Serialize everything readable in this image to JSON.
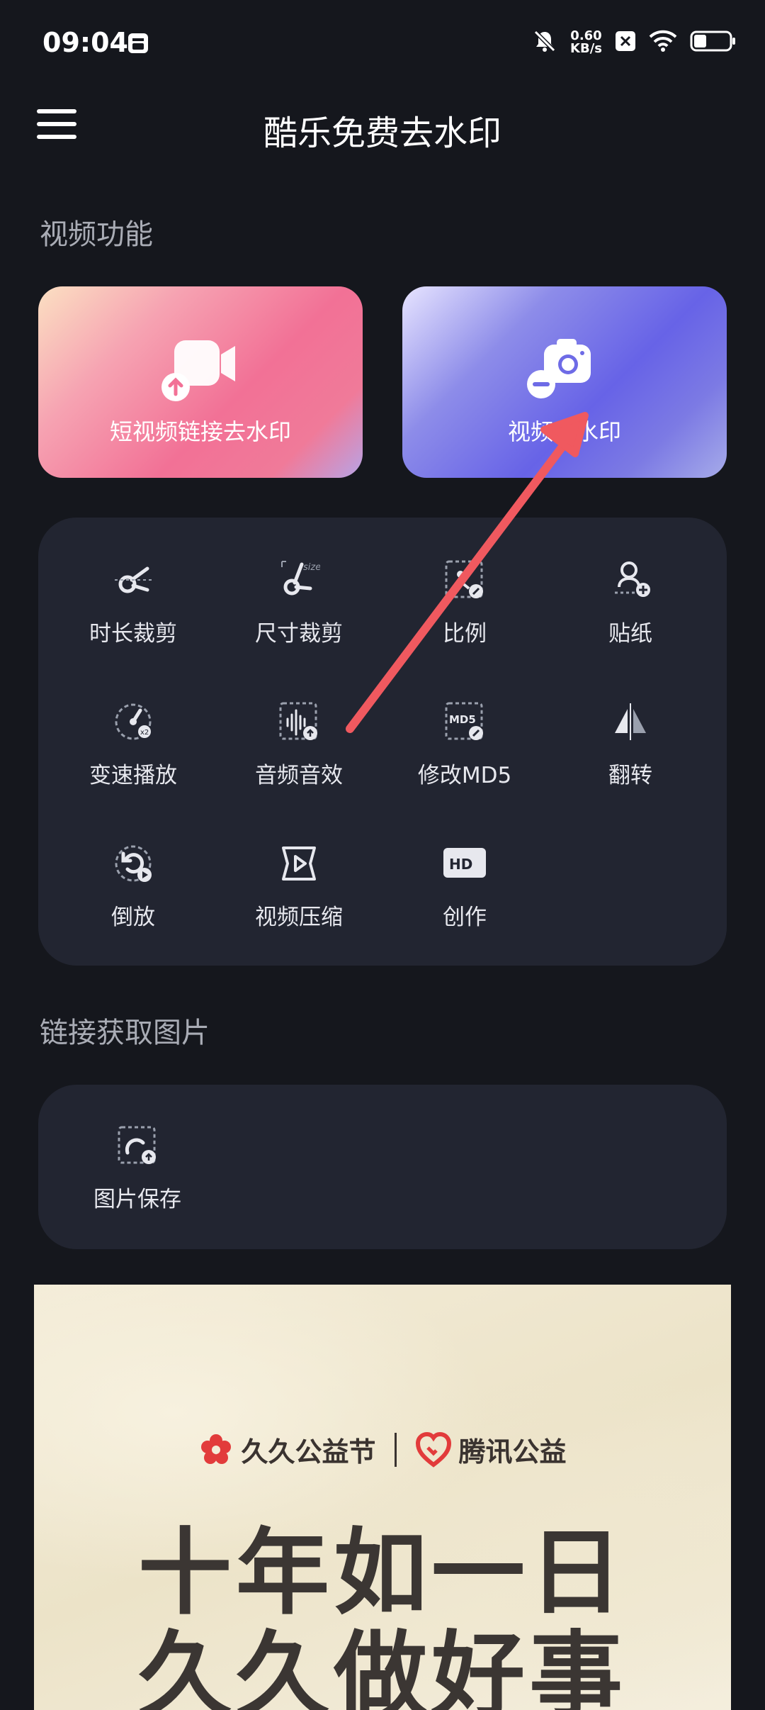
{
  "status_bar": {
    "time": "09:04",
    "net_speed_value": "0.60",
    "net_speed_unit": "KB/s",
    "icons": [
      "notification-icon",
      "mute-icon",
      "close-badge-icon",
      "wifi-icon",
      "battery-icon"
    ],
    "battery_level": 0.35
  },
  "header": {
    "title": "酷乐免费去水印",
    "menu_icon": "hamburger-menu-icon"
  },
  "video_section": {
    "title": "视频功能",
    "cards": [
      {
        "label": "短视频链接去水印",
        "icon": "video-upload-icon"
      },
      {
        "label": "视频去水印",
        "icon": "camera-remove-icon"
      }
    ],
    "tools": [
      {
        "label": "时长裁剪",
        "icon": "duration-cut-icon"
      },
      {
        "label": "尺寸裁剪",
        "icon": "size-cut-icon"
      },
      {
        "label": "比例",
        "icon": "ratio-icon"
      },
      {
        "label": "贴纸",
        "icon": "sticker-icon"
      },
      {
        "label": "变速播放",
        "icon": "speed-icon"
      },
      {
        "label": "音频音效",
        "icon": "audio-icon"
      },
      {
        "label": "修改MD5",
        "icon": "md5-icon"
      },
      {
        "label": "翻转",
        "icon": "flip-icon"
      },
      {
        "label": "倒放",
        "icon": "reverse-icon"
      },
      {
        "label": "视频压缩",
        "icon": "compress-icon"
      },
      {
        "label": "创作",
        "icon": "hd-icon"
      }
    ]
  },
  "image_section": {
    "title": "链接获取图片",
    "tools": [
      {
        "label": "图片保存",
        "icon": "image-save-icon"
      }
    ]
  },
  "banner": {
    "logo_left": "久久公益节",
    "logo_right": "腾讯公益",
    "line1": "十年如一日",
    "line2": "久久做好事"
  },
  "colors": {
    "background": "#15171d",
    "panel": "#222531",
    "card_pink": "#f27196",
    "card_purple": "#6763e7",
    "annotation_arrow": "#f0595f",
    "charity_red": "#e23b3b"
  }
}
